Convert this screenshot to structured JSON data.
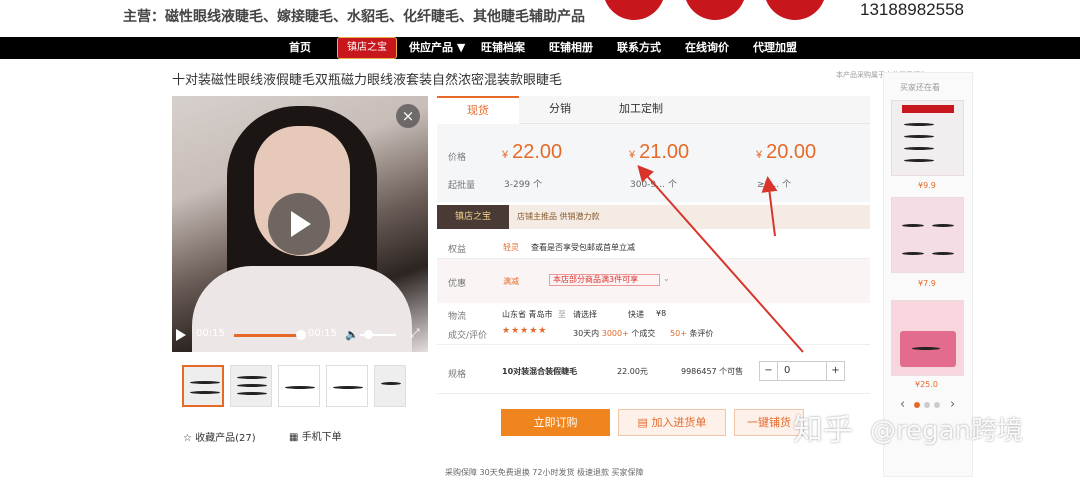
{
  "header": {
    "main_categories": "主营：磁性眼线液睫毛、嫁接睫毛、水貂毛、化纤睫毛、其他睫毛辅助产品",
    "phone": "13188982558"
  },
  "nav": {
    "items": [
      "首页",
      "供应产品 ▼",
      "旺铺档案",
      "旺铺相册",
      "联系方式",
      "在线询价",
      "代理加盟"
    ],
    "shop_badge": "镇店之宝"
  },
  "product": {
    "title": "十对装磁性眼线液假睫毛双瓶磁力眼线液套装自然浓密混装款眼睫毛",
    "side_note": "本产品采购属于商业贸易行为"
  },
  "video": {
    "close": "×",
    "time_current": "00:15",
    "time_total": "00:15",
    "progress": 0.98
  },
  "actions": {
    "favorite": "☆ 收藏产品(27)",
    "mobile_order": "手机下单"
  },
  "tabs": [
    "现货",
    "分销",
    "加工定制"
  ],
  "pricing": {
    "price_label": "价格",
    "min_order_label": "起批量",
    "currency": "¥",
    "tiers": [
      {
        "price": "22.00",
        "qty": "3-299 个"
      },
      {
        "price": "21.00",
        "qty": "300-9… 个"
      },
      {
        "price": "20.00",
        "qty": "≥9… 个"
      }
    ]
  },
  "shop_banner": {
    "tag": "镇店之宝",
    "text": "店铺主推品  供销潜力款"
  },
  "rights": {
    "label": "权益",
    "badge": "轻灵",
    "text": "查看是否享受包邮或首单立减"
  },
  "promo": {
    "label": "优惠",
    "tag": "满减",
    "box": "本店部分商品满3件可享"
  },
  "logistics": {
    "label": "物流",
    "origin": "山东省 青岛市",
    "to": "至",
    "dest": "请选择",
    "method": "快递",
    "cost": "¥8"
  },
  "reviews": {
    "label": "成交/评价",
    "stars": "★★★★★",
    "sold_prefix": "30天内",
    "sold_count": "3000+",
    "sold_suffix": "个成交",
    "review_count": "50+",
    "review_suffix": "条评价"
  },
  "spec": {
    "label": "规格",
    "name": "10对装混合装假睫毛",
    "price": "22.00元",
    "stock": "9986457 个可售",
    "minus": "−",
    "qty": "0",
    "plus": "+"
  },
  "buttons": {
    "buy": "立即订购",
    "cart": "加入进货单",
    "one_click": "一键铺货"
  },
  "bottom": {
    "text": "采购保障   30天免费退换   72小时发货   极速退款   买家保障"
  },
  "sidebar": {
    "title": "买家还在看",
    "items": [
      {
        "price": "¥9.9"
      },
      {
        "price": "¥7.9"
      },
      {
        "price": "¥25.0"
      }
    ],
    "prev": "‹",
    "next": "›"
  },
  "watermark": {
    "site": "知乎",
    "author": "@regan跨境"
  },
  "colors": {
    "accent": "#e56a2a",
    "nav_bg": "#000000",
    "brand_red": "#c8161d",
    "arrow": "#d8342a"
  }
}
